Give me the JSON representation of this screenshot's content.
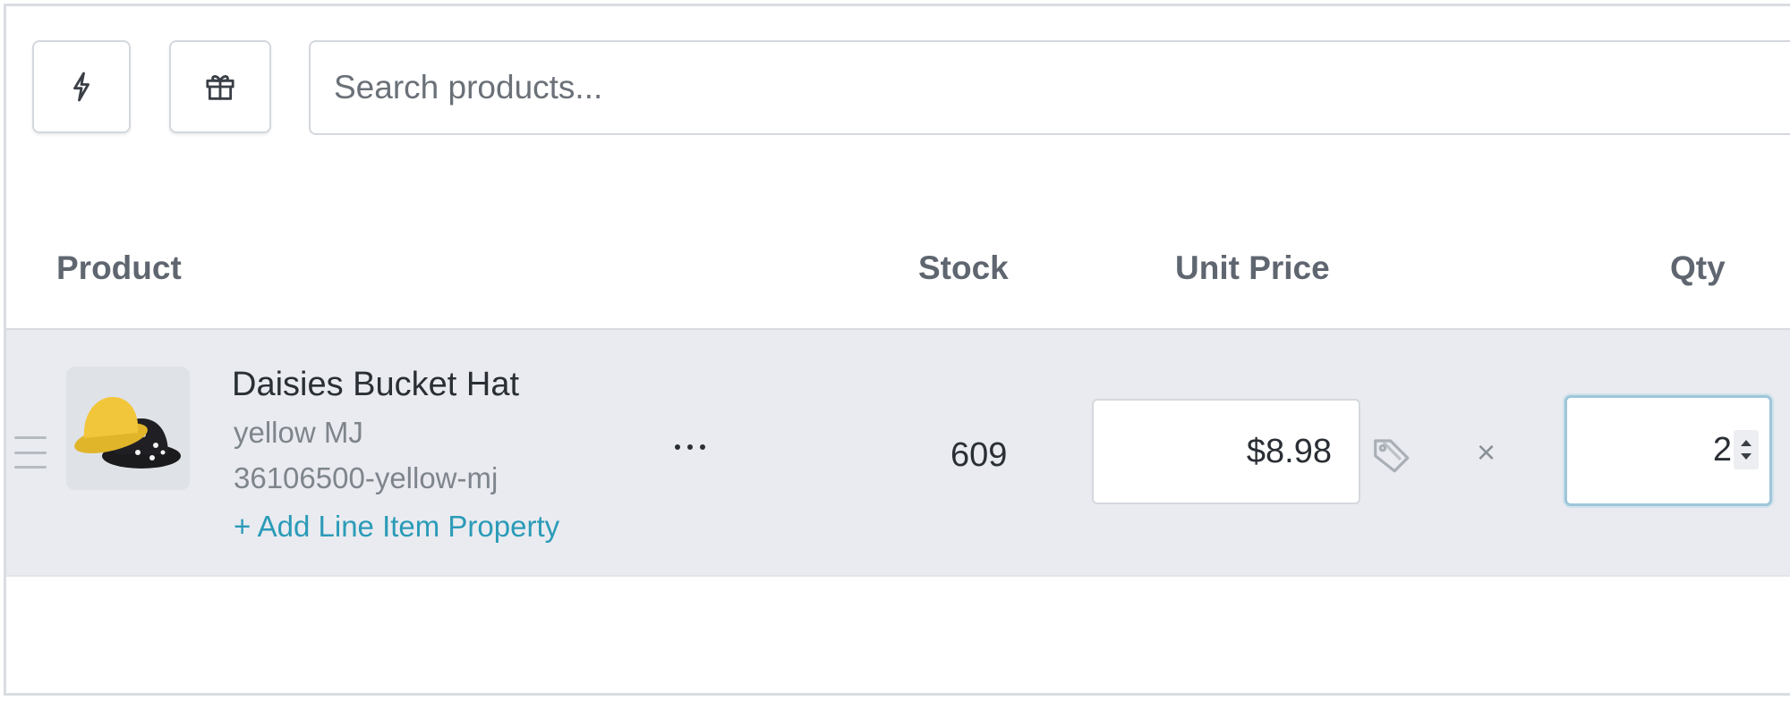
{
  "toolbar": {
    "quick_action_icon": "lightning-bolt-icon",
    "gift_icon": "gift-icon",
    "search_placeholder": "Search products..."
  },
  "table": {
    "headers": {
      "product": "Product",
      "stock": "Stock",
      "unit_price": "Unit Price",
      "qty": "Qty"
    },
    "rows": [
      {
        "name": "Daisies Bucket Hat",
        "variant": "yellow MJ",
        "sku": "36106500-yellow-mj",
        "add_property": "+ Add Line Item Property",
        "stock": "609",
        "unit_price": "$8.98",
        "multiply": "×",
        "qty": "2"
      }
    ]
  },
  "colors": {
    "link": "#2b9bb8",
    "row_bg": "#e9ebf0",
    "header_text": "#5f6670",
    "focus_ring": "#9fc6da"
  }
}
